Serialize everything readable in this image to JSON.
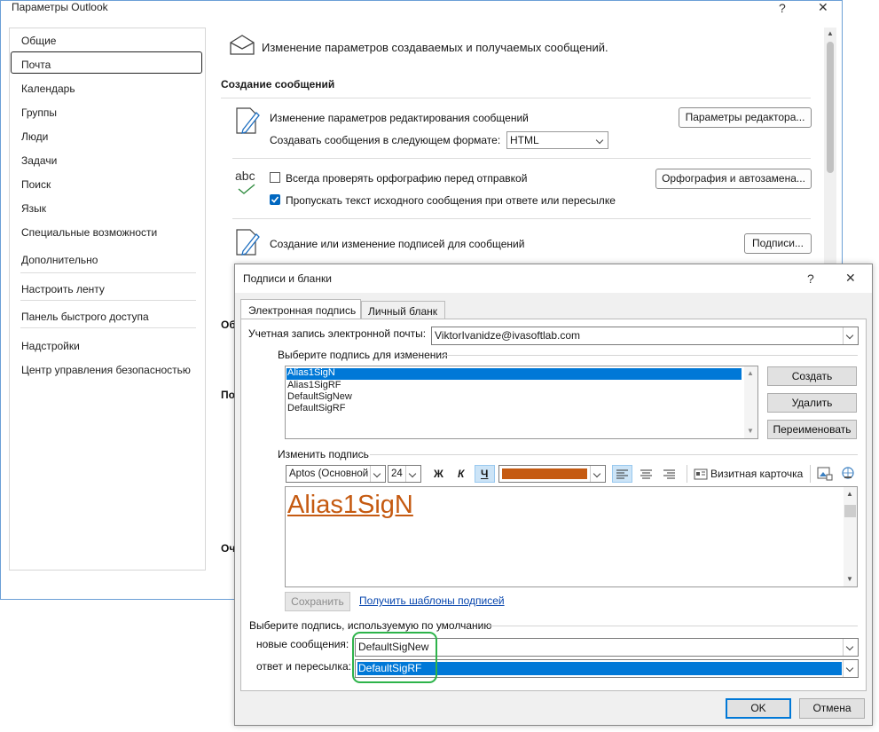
{
  "options_window": {
    "title": "Параметры Outlook",
    "help": "?",
    "close": "✕",
    "nav": [
      "Общие",
      "Почта",
      "Календарь",
      "Группы",
      "Люди",
      "Задачи",
      "Поиск",
      "Язык",
      "Специальные возможности",
      "Дополнительно",
      "Настроить ленту",
      "Панель быстрого доступа",
      "Надстройки",
      "Центр управления безопасностью"
    ],
    "selected_nav": "Почта",
    "header_text": "Изменение параметров создаваемых и получаемых сообщений.",
    "compose_section": "Создание сообщений",
    "editing_text": "Изменение параметров редактирования сообщений",
    "editor_button": "Параметры редактора...",
    "format_label": "Создавать сообщения в следующем формате:",
    "format_value": "HTML",
    "abc_label": "abc",
    "spell_check_label": "Всегда проверять орфографию перед отправкой",
    "spell_check_checked": false,
    "skip_original_label": "Пропускать текст исходного сообщения при ответе или пересылке",
    "skip_original_checked": true,
    "spelling_button": "Орфография и автозамена...",
    "signatures_text": "Создание или изменение подписей для сообщений",
    "signatures_button": "Подписи...",
    "partial_labels": [
      "Об",
      "По",
      "Оч"
    ]
  },
  "dialog": {
    "title": "Подписи и бланки",
    "help": "?",
    "close": "✕",
    "tabs": [
      "Электронная подпись",
      "Личный бланк"
    ],
    "account_label": "Учетная запись электронной почты:",
    "account_value": "ViktorIvanidze@ivasoftlab.com",
    "select_sig_label": "Выберите подпись для изменения",
    "signatures": [
      "Alias1SigN",
      "Alias1SigRF",
      "DefaultSigNew",
      "DefaultSigRF"
    ],
    "selected_signature": "Alias1SigN",
    "create_button": "Создать",
    "delete_button": "Удалить",
    "rename_button": "Переименовать",
    "edit_sig_label": "Изменить подпись",
    "font_value": "Aptos (Основной",
    "size_value": "24",
    "bold": "Ж",
    "italic": "К",
    "underline": "Ч",
    "font_color": "#c55a11",
    "business_card_button": "Визитная карточка",
    "signature_text": "Alias1SigN",
    "save_button": "Сохранить",
    "templates_link": "Получить шаблоны подписей",
    "default_sig_label": "Выберите подпись, используемую по умолчанию",
    "new_messages_label": "новые сообщения:",
    "new_messages_value": "DefaultSigNew",
    "reply_label": "ответ и пересылка:",
    "reply_value": "DefaultSigRF",
    "ok_button": "OK",
    "cancel_button": "Отмена",
    "highlight_color": "#2db34a",
    "accent_color": "#0078d7"
  }
}
